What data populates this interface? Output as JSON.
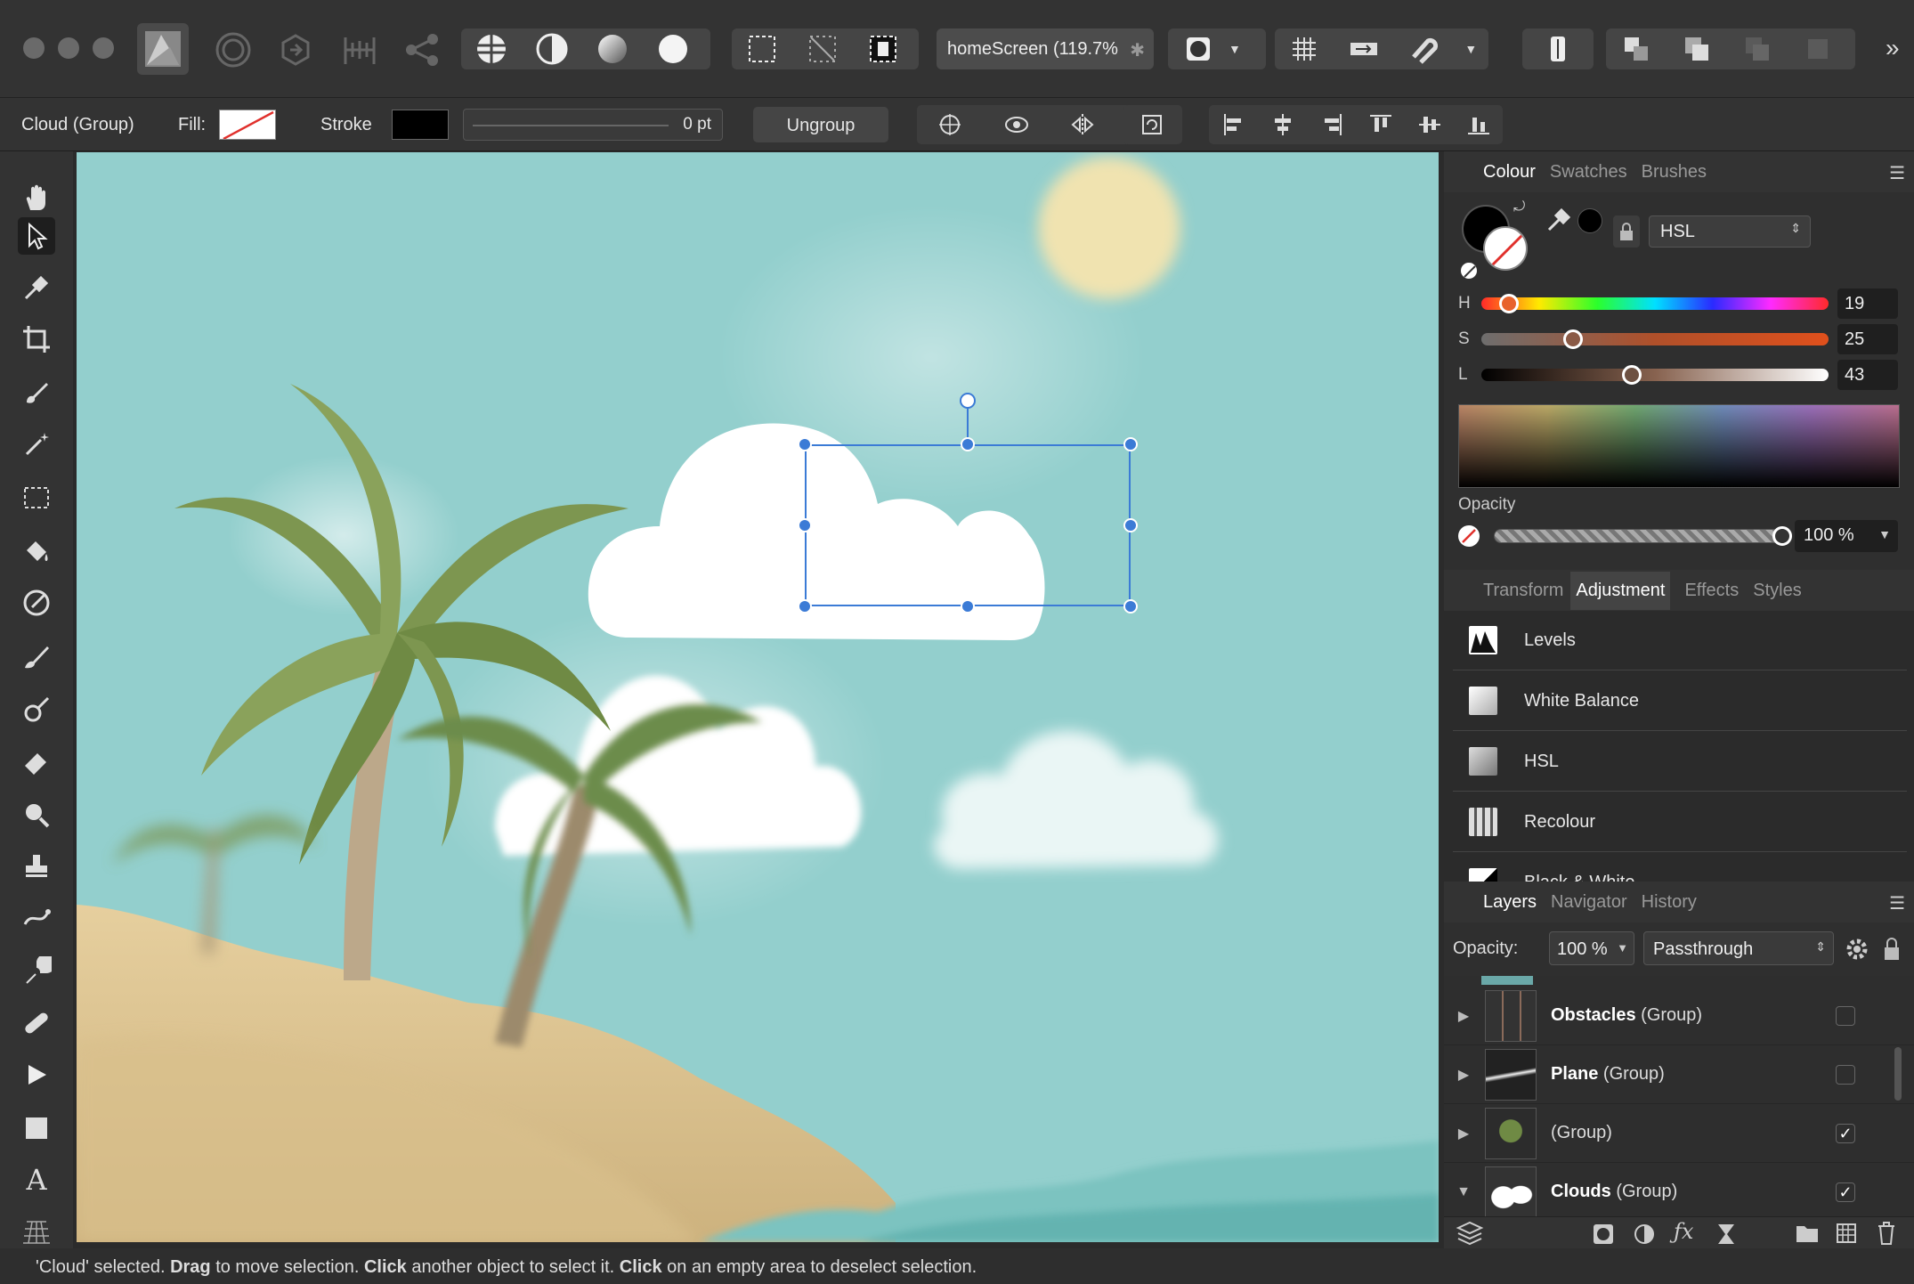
{
  "toolbar": {
    "doc_tab": "homeScreen (119.7%",
    "doc_tab_close": "✱",
    "more": "»"
  },
  "context": {
    "selection_name": "Cloud (Group)",
    "fill_label": "Fill:",
    "stroke_label": "Stroke",
    "stroke_width": "0 pt",
    "ungroup_label": "Ungroup"
  },
  "colour_panel": {
    "tabs": [
      "Colour",
      "Swatches",
      "Brushes"
    ],
    "model": "HSL",
    "h_label": "H",
    "h_value": "19",
    "s_label": "S",
    "s_value": "25",
    "l_label": "L",
    "l_value": "43",
    "h_level": 0.053,
    "s_level": 0.25,
    "l_level": 0.43,
    "opacity_label": "Opacity",
    "opacity_value": "100 %"
  },
  "adjustment_panel": {
    "tabs": [
      "Transform",
      "Adjustment",
      "Effects",
      "Styles"
    ],
    "items": [
      "Levels",
      "White Balance",
      "HSL",
      "Recolour",
      "Black & White"
    ]
  },
  "layers_panel": {
    "tabs": [
      "Layers",
      "Navigator",
      "History"
    ],
    "opacity_label": "Opacity:",
    "opacity_value": "100 %",
    "blend_mode": "Passthrough",
    "layers": [
      {
        "name": "Obstacles",
        "kind": "(Group)",
        "checked": false
      },
      {
        "name": "Plane",
        "kind": "(Group)",
        "checked": false
      },
      {
        "name": "",
        "kind": "(Group)",
        "checked": true
      },
      {
        "name": "Clouds",
        "kind": "(Group)",
        "checked": true
      }
    ]
  },
  "status": {
    "p1": "'Cloud' selected. ",
    "b1": "Drag",
    "p2": " to move selection. ",
    "b2": "Click",
    "p3": " another object to select it. ",
    "b3": "Click",
    "p4": " on an empty area to deselect selection."
  },
  "colors": {
    "sky": "#93cfcd",
    "selection": "#3b7bd6",
    "panel_bg": "#2f2f2f"
  }
}
